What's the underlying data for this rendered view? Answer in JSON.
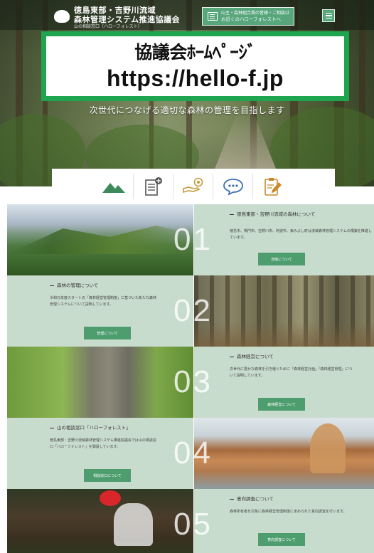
{
  "header": {
    "org_line1": "徳島東部・吉野川流域",
    "org_line2": "森林管理システム推進協議会",
    "org_line3": "山の相談窓口（ハローフォレスト）",
    "contact_line1": "山主・森林組合員の皆様・ご相談は",
    "contact_line2": "お近くのハローフォレストへ",
    "menu_icon": "hamburger-icon"
  },
  "banner": {
    "line1": "協議会ﾎｰﾑﾍﾟｰｼﾞ",
    "line2": "https://hello-f.jp"
  },
  "hero": {
    "tagline": "次世代につなげる適切な森林の管理を目指します"
  },
  "nav_icons": [
    "mountain-icon",
    "document-add-icon",
    "hand-coin-icon",
    "chat-bubble-icon",
    "clipboard-edit-icon"
  ],
  "colors": {
    "brand_green": "#4e9d6e",
    "banner_border": "#1fa54f",
    "panel_bg": "#c8dccd"
  },
  "sections": [
    {
      "number": "01",
      "title": "徳島東部・吉野川流域の森林について",
      "desc": "徳島市、鳴門市、吉野川市、阿波市、東みよし町は流域森林管理システムの構築を推進しています。",
      "button": "流域について"
    },
    {
      "number": "02",
      "title": "森林の管理について",
      "desc": "令和元年度スタートの「森林経営管理制度」に基づいた新たな森林管理システムについて説明しています。",
      "button": "管理について"
    },
    {
      "number": "03",
      "title": "森林経営について",
      "desc": "次世代に豊かな森林を引き継ぐために「森林経営計画」「森林経営管理」について説明しています。",
      "button": "森林経営について"
    },
    {
      "number": "04",
      "title": "山の相談窓口「ハローフォレスト」",
      "desc": "徳島東部・吉野川流域森林管理システム推進協議会では山の相談窓口「ハローフォレスト」を開設しています。",
      "button": "相談窓口について"
    },
    {
      "number": "05",
      "title": "意向調査について",
      "desc": "森林所有者を対象に森林経営管理制度に定められた意向調査を行います。",
      "button": "意向調査について"
    }
  ]
}
